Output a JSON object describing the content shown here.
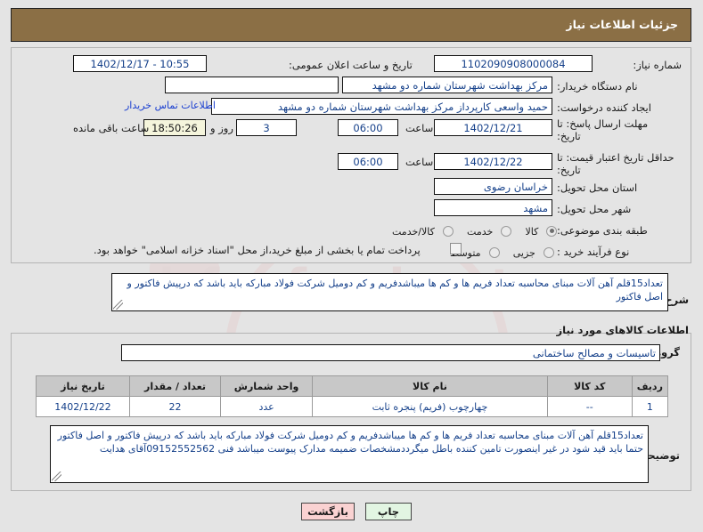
{
  "header": {
    "title": "جزئیات اطلاعات نیاز"
  },
  "form": {
    "need_number": {
      "label": "شماره نیاز:",
      "value": "1102090908000084"
    },
    "public_announce": {
      "label": "تاریخ و ساعت اعلان عمومی:",
      "value": "1402/12/17 - 10:55"
    },
    "buyer_org": {
      "label": "نام دستگاه خریدار:",
      "value": "مرکز بهداشت شهرستان شماره دو مشهد"
    },
    "creator": {
      "label": "ایجاد کننده درخواست:",
      "value": "حمید واسعی کارپرداز مرکز بهداشت شهرستان شماره دو مشهد"
    },
    "contact_link": "اطلاعات تماس خریدار",
    "blank_field": {
      "value": ""
    },
    "response_deadline": {
      "label_line1": "مهلت ارسال پاسخ: تا",
      "label_line2": "تاریخ:",
      "date": "1402/12/21",
      "time_label": "ساعت",
      "time": "06:00"
    },
    "countdown": {
      "days": "3",
      "days_label": "روز و",
      "remaining": "18:50:26",
      "remaining_label": "ساعت باقی مانده"
    },
    "price_validity": {
      "label_line1": "حداقل تاریخ اعتبار قیمت: تا",
      "label_line2": "تاریخ:",
      "date": "1402/12/22",
      "time_label": "ساعت",
      "time": "06:00"
    },
    "province": {
      "label": "استان محل تحویل:",
      "value": "خراسان رضوی"
    },
    "city": {
      "label": "شهر محل تحویل:",
      "value": "مشهد"
    },
    "category": {
      "label": "طبقه بندی موضوعی:",
      "options": [
        "کالا",
        "خدمت",
        "کالا/خدمت"
      ],
      "selected_index": 0
    },
    "purchase_type": {
      "label": "نوع فرآیند خرید :",
      "options": [
        "جزیی",
        "متوسط"
      ],
      "selected_index": -1,
      "checkbox_text": "پرداخت تمام یا بخشی از مبلغ خرید،از محل \"اسناد خزانه اسلامی\" خواهد بود.",
      "checkbox_checked": false
    }
  },
  "description": {
    "label": "شرح کلی نیاز:",
    "value": "تعداد15قلم آهن آلات مبنای محاسبه تعداد فریم ها و کم ها میباشدفریم و کم دومیل شرکت فولاد مبارکه باید باشد که درپیش فاکتور و اصل فاکتور"
  },
  "goods_section": {
    "heading": "اطلاعات کالاهای مورد نیاز",
    "group": {
      "label": "گروه کالا:",
      "value": "تاسیسات و مصالح ساختمانی"
    },
    "table": {
      "columns": [
        "ردیف",
        "کد کالا",
        "نام کالا",
        "واحد شمارش",
        "تعداد / مقدار",
        "تاریخ نیاز"
      ],
      "rows": [
        [
          "1",
          "--",
          "چهارچوب (فریم) پنجره ثابت",
          "عدد",
          "22",
          "1402/12/22"
        ]
      ]
    },
    "buyer_notes": {
      "label": "توضیحات خریدار:",
      "value": "تعداد15قلم آهن آلات مبنای محاسبه تعداد فریم ها و کم ها میباشدفریم و کم دومیل شرکت فولاد مبارکه باید باشد که درپیش فاکتور و اصل فاکتور حتما باید قید شود در غیر اینصورت تامین کننده باطل میگرددمشخصات ضمیمه مدارک پیوست میباشد فنی 09152552562آقای هدایت"
    }
  },
  "footer": {
    "back_button": "بازگشت",
    "print_button": "چاپ"
  },
  "watermark": {
    "text": "irfanfead.net"
  },
  "colors": {
    "header_bar": "#8b6f45",
    "page_bg": "#e4e4e4",
    "field_text": "#15408a",
    "link": "#1a3fd0",
    "table_header": "#c8c8c8",
    "back_button": "#fad2d2",
    "print_button": "#e2f5e2",
    "timer_bg": "#f5f5dc"
  }
}
